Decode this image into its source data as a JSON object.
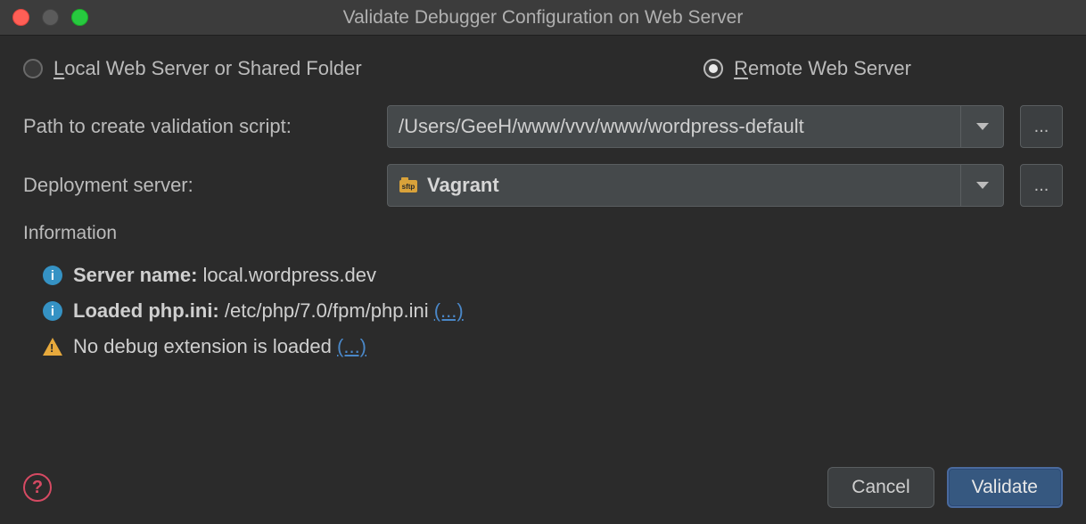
{
  "window": {
    "title": "Validate Debugger Configuration on Web Server"
  },
  "radios": {
    "local": {
      "prefix": "L",
      "rest": "ocal Web Server or Shared Folder"
    },
    "remote": {
      "prefix": "R",
      "rest": "emote Web Server"
    },
    "selected": "remote"
  },
  "form": {
    "path_label": "Path to create validation script:",
    "path_value": "/Users/GeeH/www/vvv/www/wordpress-default",
    "deploy_label": "Deployment server:",
    "deploy_value": "Vagrant",
    "ellipsis": "..."
  },
  "information": {
    "header": "Information",
    "server_name_label": "Server name:",
    "server_name_value": "local.wordpress.dev",
    "php_ini_label": "Loaded php.ini:",
    "php_ini_value": "/etc/php/7.0/fpm/php.ini",
    "link_more": "(...)",
    "no_debug": "No debug extension is loaded"
  },
  "buttons": {
    "cancel": "Cancel",
    "validate": "Validate"
  },
  "icons": {
    "help": "?",
    "info": "i"
  }
}
